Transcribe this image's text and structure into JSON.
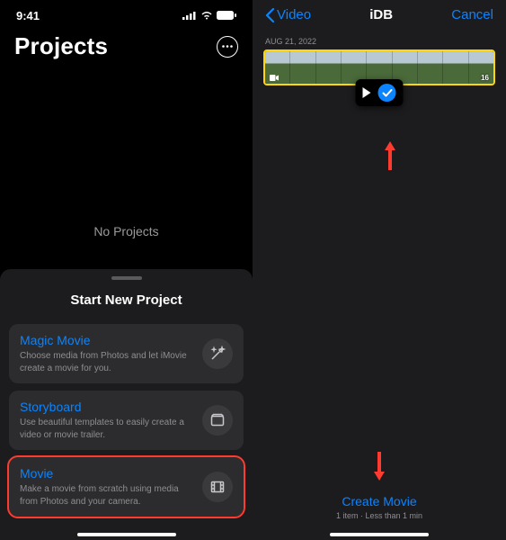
{
  "left": {
    "status_time": "9:41",
    "title": "Projects",
    "no_projects": "No Projects",
    "sheet_title": "Start New Project",
    "options": [
      {
        "title": "Magic Movie",
        "desc": "Choose media from Photos and let iMovie create a movie for you.",
        "icon": "wand-icon"
      },
      {
        "title": "Storyboard",
        "desc": "Use beautiful templates to easily create a video or movie trailer.",
        "icon": "storyboard-icon"
      },
      {
        "title": "Movie",
        "desc": "Make a movie from scratch using media from Photos and your camera.",
        "icon": "film-icon"
      }
    ]
  },
  "right": {
    "back_label": "Video",
    "title": "iDB",
    "cancel": "Cancel",
    "date": "AUG 21, 2022",
    "duration": "16",
    "create_label": "Create Movie",
    "create_sub": "1 item · Less than 1 min"
  },
  "colors": {
    "accent": "#0a84ff",
    "highlight": "#ff3b30",
    "clip_border": "#ffd60a"
  }
}
